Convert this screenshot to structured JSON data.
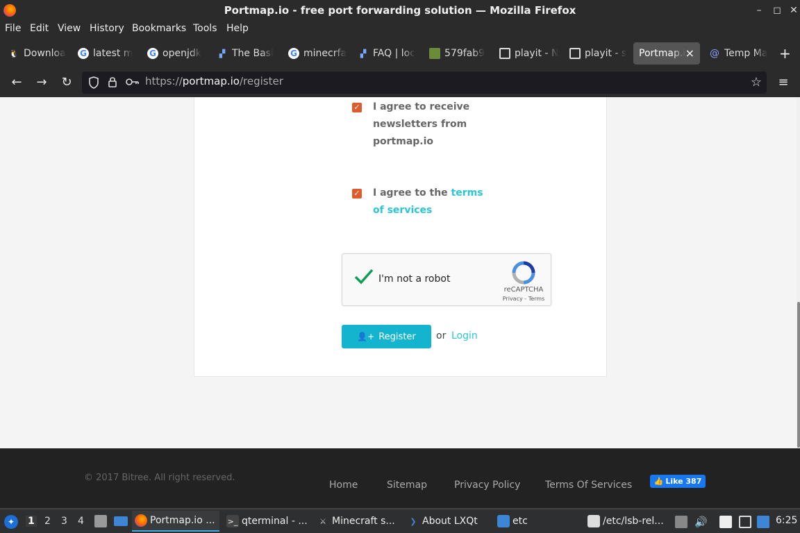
{
  "window": {
    "title": "Portmap.io - free port forwarding solution — Mozilla Firefox",
    "minimize_label": "–",
    "maximize_label": "◻",
    "close_label": "✕"
  },
  "menubar": {
    "items": [
      "File",
      "Edit",
      "View",
      "History",
      "Bookmarks",
      "Tools",
      "Help"
    ]
  },
  "tabs": [
    {
      "label": "Downloa",
      "icon": "linux-penguin-icon"
    },
    {
      "label": "latest m",
      "icon": "google-icon"
    },
    {
      "label": "openjdk",
      "icon": "google-icon"
    },
    {
      "label": "The Basi",
      "icon": "site-icon"
    },
    {
      "label": "minecrfa",
      "icon": "google-icon"
    },
    {
      "label": "FAQ | loc",
      "icon": "site-icon"
    },
    {
      "label": "579fab9",
      "icon": "minecraft-block-icon"
    },
    {
      "label": "playit - N",
      "icon": "playit-icon"
    },
    {
      "label": "playit - s",
      "icon": "playit-icon"
    },
    {
      "label": "Portmap.i",
      "icon": "none",
      "active": true
    },
    {
      "label": "Temp Ma",
      "icon": "email-at-icon"
    }
  ],
  "new_tab_label": "+",
  "close_tab_label": "×",
  "url": {
    "prefix": "https://",
    "host": "portmap.io",
    "path": "/register"
  },
  "form": {
    "newsletter_label": "I agree to receive newsletters from portmap.io",
    "newsletter_checked": true,
    "terms_prefix": "I agree to the ",
    "terms_link": "terms of services",
    "terms_checked": true,
    "captcha": {
      "label": "I'm not a robot",
      "brand": "reCAPTCHA",
      "links": "Privacy - Terms",
      "checked": true
    },
    "register_label": "Register",
    "or_text": "or",
    "login_label": "Login"
  },
  "footer": {
    "copyright": "© 2017 Bitree. All right reserved.",
    "links": [
      "Home",
      "Sitemap",
      "Privacy Policy",
      "Terms Of Services"
    ],
    "like_label": "Like 387"
  },
  "taskbar": {
    "workspaces": [
      "1",
      "2",
      "3",
      "4"
    ],
    "current_workspace": "1",
    "items": [
      {
        "label": "Portmap.io ...",
        "icon": "firefox-icon",
        "active": true
      },
      {
        "label": "qterminal - ...",
        "icon": "terminal-icon"
      },
      {
        "label": "Minecraft s...",
        "icon": "minecraft-icon"
      },
      {
        "label": "About LXQt",
        "icon": "lxqt-icon"
      },
      {
        "label": "etc",
        "icon": "folder-icon"
      },
      {
        "label": "/etc/lsb-rel...",
        "icon": "text-editor-icon"
      }
    ],
    "clock": "6:25"
  },
  "colors": {
    "accent": "#14b4cf",
    "link": "#2ac6d8",
    "checkbox": "#e05b2a",
    "chrome_dark": "#2b2b2b",
    "footer_bg": "#222222"
  }
}
